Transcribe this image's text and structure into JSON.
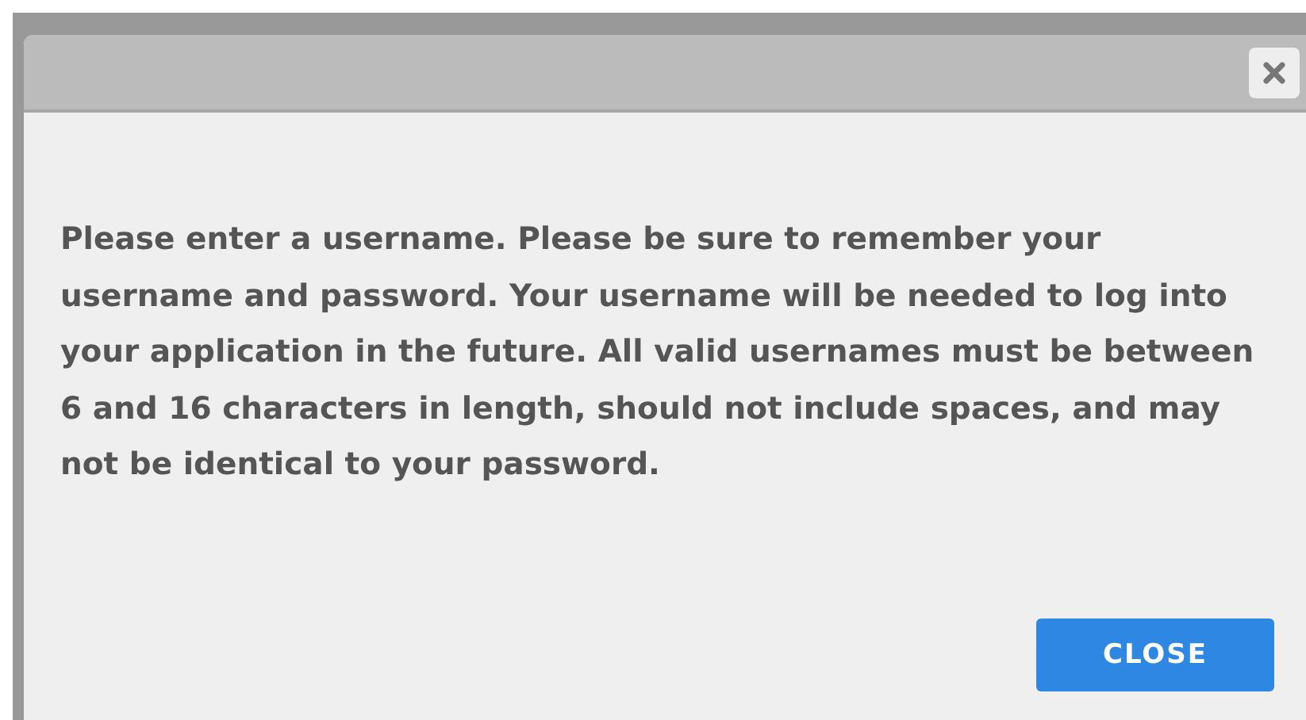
{
  "dialog": {
    "message": "Please enter a username. Please be sure to remember your username and password. Your username will be needed to log into your application in the future. All valid usernames must be between 6 and 16 characters in length, should not include spaces, and may not be identical to your password.",
    "buttons": [
      "CLOSE"
    ]
  }
}
